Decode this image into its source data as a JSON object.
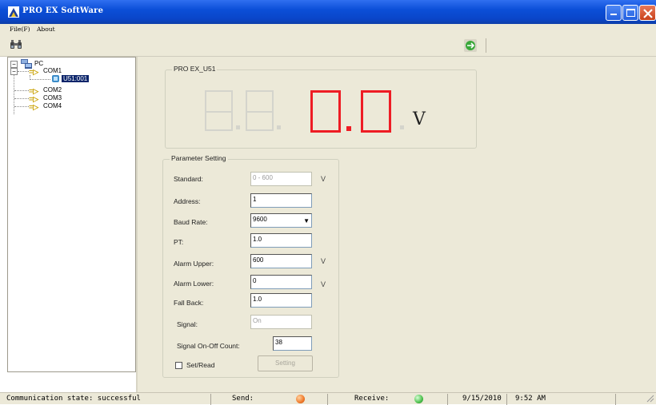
{
  "window": {
    "title": "PRO EX SoftWare"
  },
  "menu": {
    "items": [
      {
        "label": "File(F)"
      },
      {
        "label": "About"
      }
    ]
  },
  "tree": {
    "root": "PC",
    "ports": [
      "COM1",
      "COM2",
      "COM3",
      "COM4"
    ],
    "device": "U51:001"
  },
  "display": {
    "group_title": "PRO EX_U51",
    "unit": "V",
    "value": "0.0"
  },
  "params": {
    "group_title": "Parameter Setting",
    "standard_label": "Standard:",
    "standard_value": "0 - 600",
    "address_label": "Address:",
    "address_value": "1",
    "baud_label": "Baud Rate:",
    "baud_value": "9600",
    "pt_label": "PT:",
    "pt_value": "1.0",
    "alarm_upper_label": "Alarm Upper:",
    "alarm_upper_value": "600",
    "alarm_lower_label": "Alarm Lower:",
    "alarm_lower_value": "0",
    "fall_back_label": "Fall Back:",
    "fall_back_value": "1.0",
    "signal_label": "Signal:",
    "signal_value": "On",
    "signal_count_label": "Signal On-Off Count:",
    "signal_count_value": "38",
    "check_mark": "V",
    "setread_label": "Set/Read",
    "setting_button": "Setting"
  },
  "status": {
    "comm_state": "Communication state: successful",
    "send_label": "Send:",
    "receive_label": "Receive:",
    "date": "9/15/2010",
    "time": "9:52 AM"
  },
  "colors": {
    "title_blue": "#0b4fd8",
    "digit_red": "#ee1c24",
    "send_led": "#f07a2a",
    "receive_led": "#4cc04c"
  }
}
